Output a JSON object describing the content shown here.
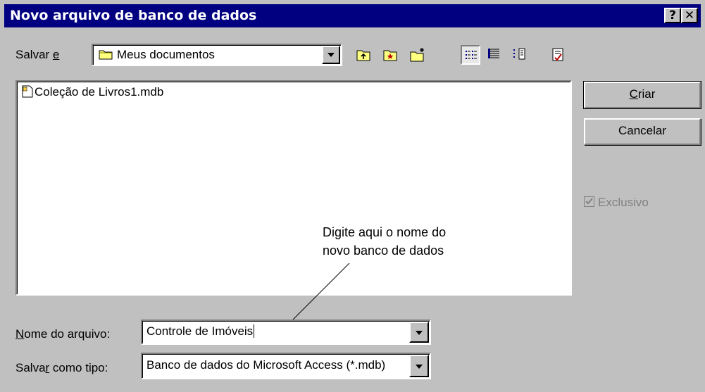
{
  "window": {
    "title": "Novo arquivo de banco de dados",
    "help_btn": "?",
    "close_btn": "✕"
  },
  "save_in": {
    "label_pre": "Salvar ",
    "label_key": "e",
    "value": "Meus documentos"
  },
  "toolbar": {
    "icons": [
      "up-one-level-icon",
      "look-in-favorites-icon",
      "create-new-folder-icon",
      "list-view-icon",
      "details-view-icon",
      "properties-view-icon",
      "commands-icon"
    ]
  },
  "files": [
    {
      "name": "Coleção de Livros1.mdb",
      "icon": "access-database-icon"
    }
  ],
  "buttons": {
    "create_key": "C",
    "create_rest": "riar",
    "cancel": "Cancelar"
  },
  "exclusive": {
    "label": "Exclusivo",
    "checked": true,
    "enabled": false
  },
  "callout": {
    "line1": "Digite aqui o nome do",
    "line2": "novo banco de dados"
  },
  "filename": {
    "label_key": "N",
    "label_rest": "ome do arquivo:",
    "value": "Controle de Imóveis"
  },
  "filetype": {
    "label_pre": "Salva",
    "label_key": "r",
    "label_rest": " como tipo:",
    "value": "Banco de dados do Microsoft Access (*.mdb)"
  }
}
